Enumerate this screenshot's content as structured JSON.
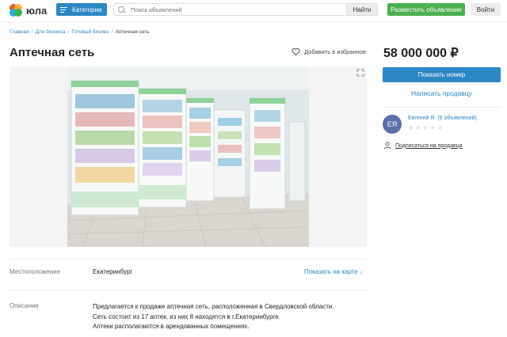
{
  "header": {
    "logo_text": "юла",
    "categories_label": "Категории",
    "search_placeholder": "Поиск объявлений",
    "find_label": "Найти",
    "post_label": "Разместить объявление",
    "login_label": "Войти"
  },
  "breadcrumb": [
    "Главная",
    "Для бизнеса",
    "Готовый бизнес",
    "Аптечная сеть"
  ],
  "listing": {
    "title": "Аптечная сеть",
    "favorite_label": "Добавить в избранное",
    "price": "58 000 000 ₽",
    "location_label": "Местоположение",
    "location_value": "Екатеринбург",
    "map_link": "Показать на карте ↓",
    "description_label": "Описание",
    "description_lines": [
      "Предлагается к продаже аптечная сеть, расположенная в Свердловской области.",
      "Сеть состоит из 17 аптек, из них 8 находятся в г.Екатеринбурге.",
      "Аптеки располагаются в арендованных помещениях."
    ]
  },
  "seller": {
    "show_phone_label": "Показать номер",
    "write_label": "Написать продавцу",
    "avatar_initials": "ЕЯ",
    "name": "Евгений Я. (5 объявлений)",
    "rating_stars": 0,
    "subscribe_label": "Подписаться на продавца"
  },
  "colors": {
    "primary": "#2d86c4",
    "post_button": "#4caf50",
    "avatar": "#5b6fa8"
  },
  "icons": [
    "logo-icon",
    "menu-icon",
    "search-icon",
    "heart-icon",
    "expand-icon",
    "user-icon",
    "star-icon"
  ]
}
